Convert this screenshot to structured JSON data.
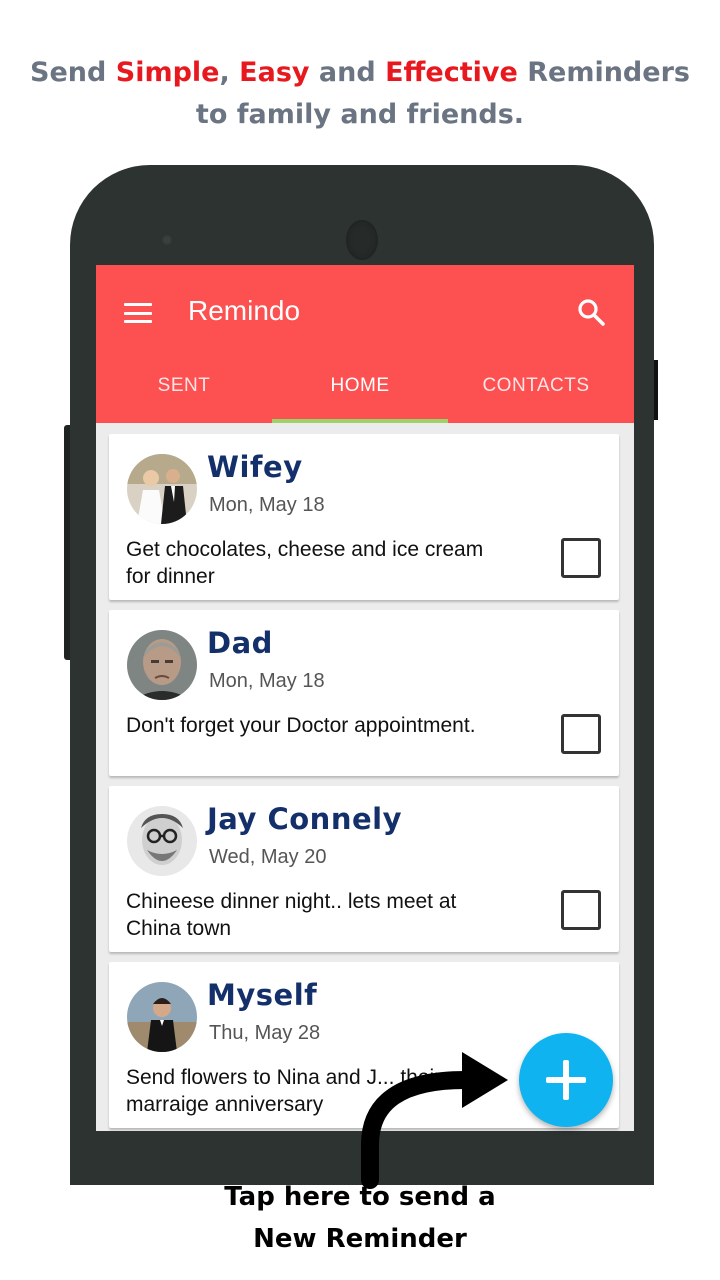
{
  "headline": {
    "line1": [
      {
        "text": "Send ",
        "style": "gray"
      },
      {
        "text": "Simple",
        "style": "red"
      },
      {
        "text": ", ",
        "style": "gray"
      },
      {
        "text": "Easy",
        "style": "red"
      },
      {
        "text": " and ",
        "style": "gray"
      },
      {
        "text": "Effective",
        "style": "red"
      },
      {
        "text": " Reminders",
        "style": "gray"
      }
    ],
    "line2": "to family and friends."
  },
  "app": {
    "title": "Remindo",
    "menu_icon": "hamburger-menu-icon",
    "search_icon": "search-icon",
    "tabs": [
      {
        "label": "SENT",
        "active": false
      },
      {
        "label": "HOME",
        "active": true
      },
      {
        "label": "CONTACTS",
        "active": false
      }
    ],
    "reminders": [
      {
        "name": "Wifey",
        "date": "Mon, May 18",
        "message": "Get chocolates,  cheese and ice cream for dinner",
        "checked": false
      },
      {
        "name": "Dad",
        "date": "Mon, May 18",
        "message": "Don't forget your Doctor appointment.",
        "checked": false
      },
      {
        "name": "Jay Connely",
        "date": "Wed, May 20",
        "message": "Chineese dinner night.. lets meet at China town",
        "checked": false
      },
      {
        "name": "Myself",
        "date": "Thu, May 28",
        "message": "Send flowers to Nina and J... their marraige anniversary",
        "checked": false
      }
    ],
    "fab_icon": "plus-icon"
  },
  "cta": {
    "line1": "Tap here to send a",
    "line2": "New Reminder"
  },
  "colors": {
    "appbar": "#fd5051",
    "tab_indicator": "#9dd16a",
    "fab": "#0eb3f0",
    "name_text": "#14306b",
    "headline_gray": "#6b7482",
    "headline_red": "#e8191e"
  }
}
